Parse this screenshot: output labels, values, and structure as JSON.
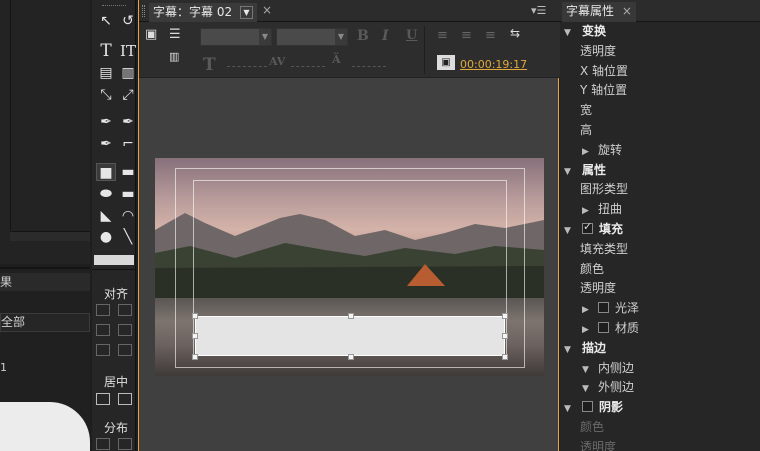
{
  "center_panel": {
    "tab_label": "字幕：字幕 02",
    "tab_menu_icon": "menu-icon",
    "timecode": "00:00:19:17"
  },
  "right_panel": {
    "tab_label": "字幕属性",
    "properties": [
      {
        "label": "变换",
        "kind": "section",
        "expanded": true
      },
      {
        "label": "透明度",
        "kind": "item"
      },
      {
        "label": "X 轴位置",
        "kind": "item"
      },
      {
        "label": "Y 轴位置",
        "kind": "item"
      },
      {
        "label": "宽",
        "kind": "item"
      },
      {
        "label": "高",
        "kind": "item"
      },
      {
        "label": "旋转",
        "kind": "collapsed"
      },
      {
        "label": "属性",
        "kind": "section",
        "expanded": true
      },
      {
        "label": "图形类型",
        "kind": "item"
      },
      {
        "label": "扭曲",
        "kind": "collapsed"
      },
      {
        "label": "填充",
        "kind": "section-check",
        "checked": true
      },
      {
        "label": "填充类型",
        "kind": "item"
      },
      {
        "label": "颜色",
        "kind": "item"
      },
      {
        "label": "透明度",
        "kind": "item"
      },
      {
        "label": "光泽",
        "kind": "collapsed-check",
        "checked": false
      },
      {
        "label": "材质",
        "kind": "collapsed-check",
        "checked": false
      },
      {
        "label": "描边",
        "kind": "section",
        "expanded": true
      },
      {
        "label": "内侧边",
        "kind": "expanded-sub"
      },
      {
        "label": "外侧边",
        "kind": "expanded-sub"
      },
      {
        "label": "阴影",
        "kind": "section-check",
        "checked": false
      },
      {
        "label": "颜色",
        "kind": "disabled"
      },
      {
        "label": "透明度",
        "kind": "disabled"
      }
    ]
  },
  "tools_panel": {
    "align_label": "对齐",
    "center_label": "居中",
    "distribute_label": "分布"
  },
  "left_panel": {
    "tab_label": "果",
    "filter_value": "全部",
    "row_value": "1"
  }
}
